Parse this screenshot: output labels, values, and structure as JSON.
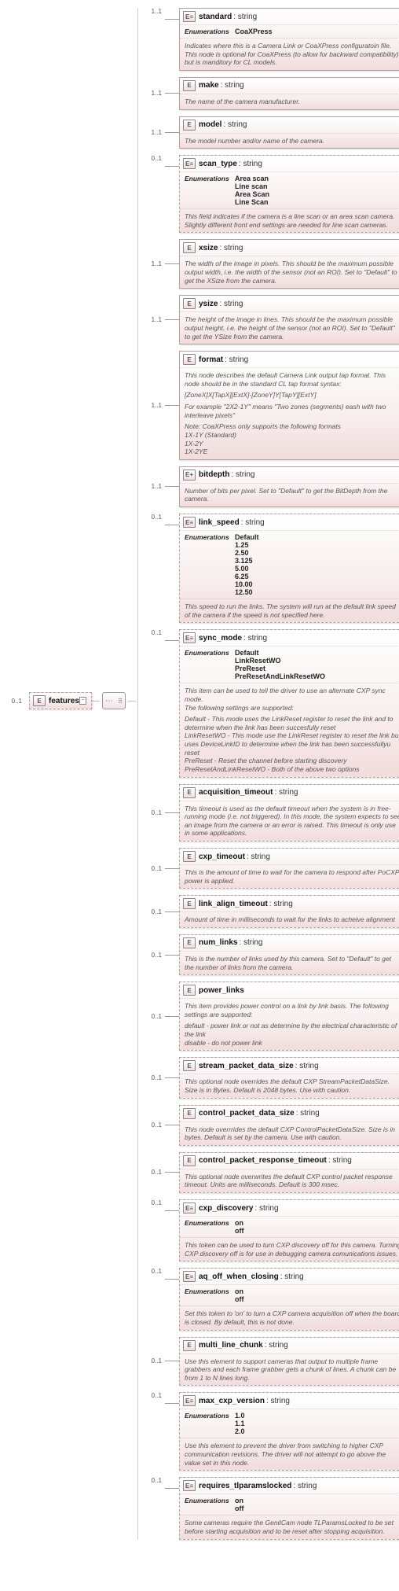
{
  "root": {
    "icon": "E",
    "name": "features",
    "occurs": "0..1"
  },
  "type_prefix": ": ",
  "nodes": [
    {
      "icon": "E≡",
      "name": "standard",
      "type": "string",
      "occurs": "1..1",
      "enum": [
        "CoaXPress"
      ],
      "desc": [
        "Indicates where this is a Camera Link or CoaXPress configuratoin file. This node is optional for CoaXPress (to allow for backward compatibility) but is manditory for CL models."
      ]
    },
    {
      "icon": "E",
      "name": "make",
      "type": "string",
      "occurs": "1..1",
      "desc": [
        "The name of the camera manufacturer."
      ]
    },
    {
      "icon": "E",
      "name": "model",
      "type": "string",
      "occurs": "1..1",
      "desc": [
        "The model number and/or name of the camera."
      ]
    },
    {
      "icon": "E≡",
      "name": "scan_type",
      "type": "string",
      "occurs": "0..1",
      "dashed": true,
      "enum": [
        "Area scan",
        "Line scan",
        "Area Scan",
        "Line Scan"
      ],
      "desc": [
        "This field indicates if the camera is a line scan or an area scan camera. Slightly different front end settings are needed for line scan cameras."
      ]
    },
    {
      "icon": "E",
      "name": "xsize",
      "type": "string",
      "occurs": "1..1",
      "desc": [
        "The width of the image in pixels. This should be the maximum possible output width, i.e. the width of the sensor (not an ROI). Set to \"Default\" to get the XSize from the camera."
      ]
    },
    {
      "icon": "E",
      "name": "ysize",
      "type": "string",
      "occurs": "1..1",
      "desc": [
        "The height of the image in lines. This should be the maximum possible output height, i.e. the height of the sensor (not an ROI). Set to \"Default\" to get the YSize from the camera."
      ]
    },
    {
      "icon": "E",
      "name": "format",
      "type": "string",
      "occurs": "1..1",
      "desc": [
        "This node describes the default Camera Link output tap format. This node should be in the standard CL tap format syntax:",
        "[ZoneX]X[TapX][ExtX]-[ZoneY]Y[TapY][ExtY]",
        "For example \"2X2-1Y\" means \"Two zones (segments) eash with two interleave pixels\"",
        "Note: CoaXPress only supports the following formats\n1X-1Y (Standard)\n1X-2Y\n1X-2YE"
      ]
    },
    {
      "icon": "E+",
      "name": "bitdepth",
      "type": "string",
      "occurs": "1..1",
      "expandable": true,
      "desc": [
        "Number of bits per pixel. Set to \"Default\" to get the BitDepth from the camera."
      ]
    },
    {
      "icon": "E≡",
      "name": "link_speed",
      "type": "string",
      "occurs": "0..1",
      "dashed": true,
      "enum": [
        "Default",
        "1.25",
        "2.50",
        "3.125",
        "5.00",
        "6.25",
        "10.00",
        "12.50"
      ],
      "desc": [
        "This speed to run the links. The system will run at the default link speed of the camera if the speed is not specified here."
      ]
    },
    {
      "icon": "E≡",
      "name": "sync_mode",
      "type": "string",
      "occurs": "0..1",
      "dashed": true,
      "enum": [
        "Default",
        "LinkResetWO",
        "PreReset",
        "PreResetAndLinkResetWO"
      ],
      "desc": [
        "This item can be used to tell the driver to use an alternate CXP sync mode.\nThe following settings are supported:",
        "Default - This mode uses the LinkReset register to reset the link and to determine when the link has been succesfully reset\nLinkResetWO - This mode use the LinkReset register to reset the link but uses DeviceLinkID to determine when the link has been successfullyu reset\nPreReset - Reset the channel before starting discovery\nPreResetAndLinkResetWO - Both of the above two options"
      ]
    },
    {
      "icon": "E",
      "name": "acquisition_timeout",
      "type": "string",
      "occurs": "0..1",
      "dashed": true,
      "desc": [
        "This timeout is used as the default timeout when the system is in free-running mode (i.e. not triggered). In this mode, the system expects to see an image from the camera or an error is raised. This timeout is only use in some applications."
      ]
    },
    {
      "icon": "E",
      "name": "cxp_timeout",
      "type": "string",
      "occurs": "0..1",
      "dashed": true,
      "desc": [
        "This is the amount of time to wait for the camera to respond after PoCXP power is applied."
      ]
    },
    {
      "icon": "E",
      "name": "link_align_timeout",
      "type": "string",
      "occurs": "0..1",
      "dashed": true,
      "desc": [
        "Amount of time in milliseconds to wait for the links to acheive alignment"
      ]
    },
    {
      "icon": "E",
      "name": "num_links",
      "type": "string",
      "occurs": "0..1",
      "dashed": true,
      "desc": [
        "This is the number of links used by this camera. Set to \"Default\" to get the number of links from the camera."
      ]
    },
    {
      "icon": "E",
      "name": "power_links",
      "occurs": "0..1",
      "dashed": true,
      "expandable": true,
      "desc": [
        "This item provides power control on a link by link basis. The following settings are supported:",
        "default - power link or not as determine by the electrical characteristic of the link\ndisable - do not power link"
      ]
    },
    {
      "icon": "E",
      "name": "stream_packet_data_size",
      "type": "string",
      "occurs": "0..1",
      "dashed": true,
      "desc": [
        "This optional node overrides the default CXP StreamPacketDataSize. Size is in Bytes. Default is 2048 bytes. Use with caution."
      ]
    },
    {
      "icon": "E",
      "name": "control_packet_data_size",
      "type": "string",
      "occurs": "0..1",
      "dashed": true,
      "desc": [
        "This node overrrides the default CXP ControlPacketDataSize. Size is in bytes. Default is set by the camera. Use with caution."
      ]
    },
    {
      "icon": "E",
      "name": "control_packet_response_timeout",
      "type": "string",
      "occurs": "0..1",
      "dashed": true,
      "desc": [
        "This optional node overwrites the default CXP control packet response timeout. Units are milliseconds. Default is 300 msec."
      ]
    },
    {
      "icon": "E≡",
      "name": "cxp_discovery",
      "type": "string",
      "occurs": "0..1",
      "dashed": true,
      "enum": [
        "on",
        "off"
      ],
      "desc": [
        "This token can be used to turn CXP discovery off for this camera. Turning CXP discovery off is for use in debugging camera comunications issues."
      ]
    },
    {
      "icon": "E≡",
      "name": "aq_off_when_closing",
      "type": "string",
      "occurs": "0..1",
      "dashed": true,
      "enum": [
        "on",
        "off"
      ],
      "desc": [
        "Set this token to 'on' to turn a CXP camera acquisition off when the board is closed. By default, this is not done."
      ]
    },
    {
      "icon": "E",
      "name": "multi_line_chunk",
      "type": "string",
      "occurs": "0..1",
      "dashed": true,
      "desc": [
        "Use this element to support cameras that output to multiple frame grabbers and each frame grabber gets a chunk of lines. A chunk can be from 1 to N lines long."
      ]
    },
    {
      "icon": "E≡",
      "name": "max_cxp_version",
      "type": "string",
      "occurs": "0..1",
      "dashed": true,
      "enum": [
        "1.0",
        "1.1",
        "2.0"
      ],
      "desc": [
        "Use this element to prevent the driver from switching to higher CXP communication revisions. The driver will not attempt to go above the value set in this node."
      ]
    },
    {
      "icon": "E≡",
      "name": "requires_tlparamslocked",
      "type": "string",
      "occurs": "0..1",
      "dashed": true,
      "enum": [
        "on",
        "off"
      ],
      "desc": [
        "Some cameras require the GeniICam node TLParamsLocked to be set before starting acquisition and to be reset after stopping acquisition."
      ]
    }
  ],
  "enum_label": "Enumerations"
}
